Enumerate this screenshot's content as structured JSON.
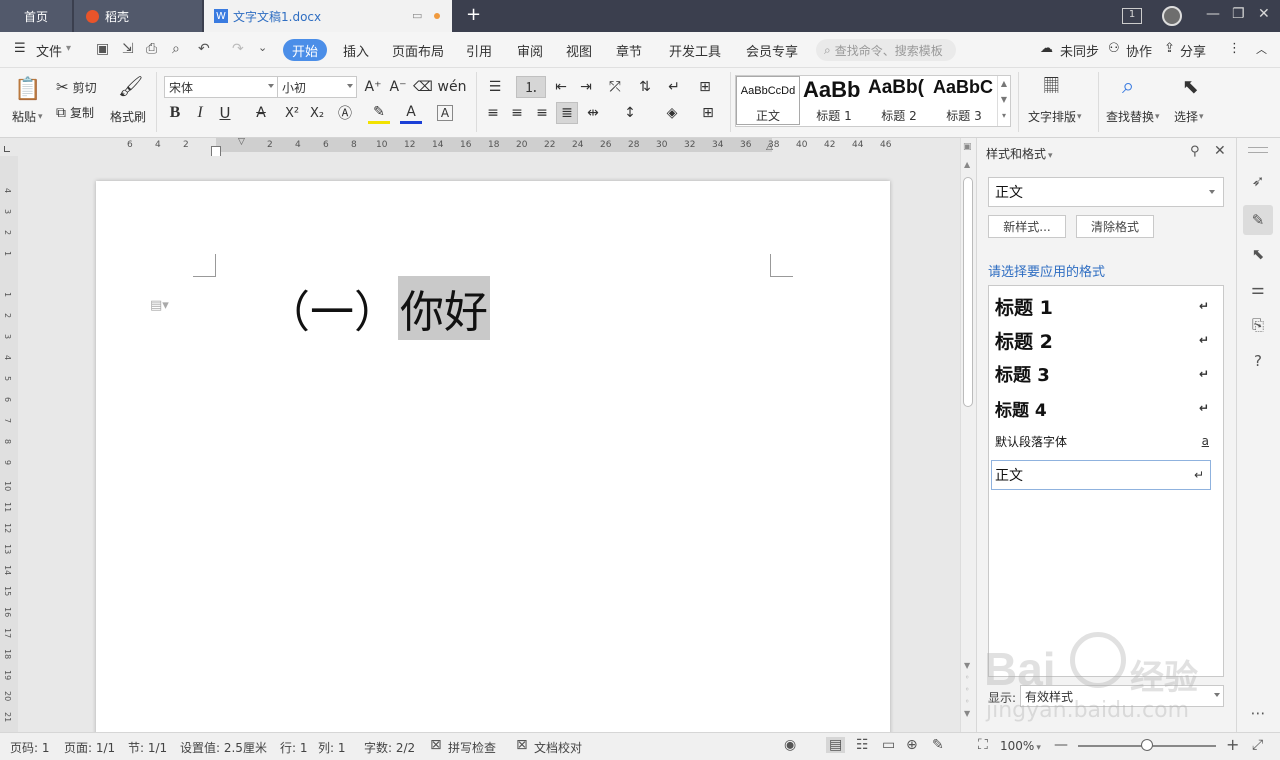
{
  "titlebar": {
    "tab_home": "首页",
    "tab_daoke": "稻壳",
    "tab_doc": "文字文稿1.docx",
    "doc_icon_letter": "W",
    "new_tab": "+"
  },
  "menubar": {
    "file": "文件",
    "tabs": [
      "开始",
      "插入",
      "页面布局",
      "引用",
      "审阅",
      "视图",
      "章节",
      "开发工具",
      "会员专享"
    ],
    "search_placeholder": "查找命令、搜索模板",
    "unsynced": "未同步",
    "collab": "协作",
    "share": "分享"
  },
  "ribbon": {
    "paste": "粘贴",
    "cut": "剪切",
    "copy": "复制",
    "format_painter": "格式刷",
    "font_name": "宋体",
    "font_size": "小初",
    "styles": [
      {
        "sample": "AaBbCcDd",
        "name": "正文"
      },
      {
        "sample": "AaBb",
        "name": "标题 1"
      },
      {
        "sample": "AaBb(",
        "name": "标题 2"
      },
      {
        "sample": "AaBbC",
        "name": "标题 3"
      }
    ],
    "text_layout": "文字排版",
    "find_replace": "查找替换",
    "select": "选择"
  },
  "ruler": {
    "left_ticks": [
      "6",
      "4",
      "2"
    ],
    "ticks": [
      "2",
      "4",
      "6",
      "8",
      "10",
      "12",
      "14",
      "16",
      "18",
      "20",
      "22",
      "24",
      "26",
      "28",
      "30",
      "32",
      "34",
      "36",
      "38",
      "40",
      "42",
      "44",
      "46"
    ],
    "v_ticks_top": [
      "4",
      "3",
      "2",
      "1"
    ],
    "v_ticks": [
      "1",
      "2",
      "3",
      "4",
      "5",
      "6",
      "7",
      "8",
      "9",
      "10",
      "11",
      "12",
      "13",
      "14",
      "15",
      "16",
      "17",
      "18",
      "19",
      "20",
      "21"
    ]
  },
  "document": {
    "heading_prefix": "（一）",
    "heading_text": "你好"
  },
  "style_pane": {
    "title": "样式和格式",
    "current_style": "正文",
    "new_style": "新样式...",
    "clear_format": "清除格式",
    "prompt": "请选择要应用的格式",
    "items": [
      {
        "label": "标题 1",
        "mark": "↵"
      },
      {
        "label": "标题 2",
        "mark": "↵"
      },
      {
        "label": "标题 3",
        "mark": "↵"
      },
      {
        "label": "标题 4",
        "mark": "↵"
      },
      {
        "label": "默认段落字体",
        "mark": "a"
      },
      {
        "label": "正文",
        "mark": "↵"
      }
    ],
    "show_label": "显示:",
    "show_value": "有效样式"
  },
  "statusbar": {
    "page_num": "页码: 1",
    "pages": "页面: 1/1",
    "section": "节: 1/1",
    "setting": "设置值: 2.5厘米",
    "row": "行: 1",
    "col": "列: 1",
    "words": "字数: 2/2",
    "spell": "拼写检查",
    "proof": "文档校对",
    "zoom": "100%",
    "zoom_fraction": 0.5
  },
  "watermark": {
    "brand": "Bai",
    "brand2": "经验",
    "url": "jingyan.baidu.com"
  },
  "colors": {
    "accent": "#4b8ee8",
    "titlebar": "#3b3f4e",
    "pane_prompt": "#2f6ec2"
  }
}
